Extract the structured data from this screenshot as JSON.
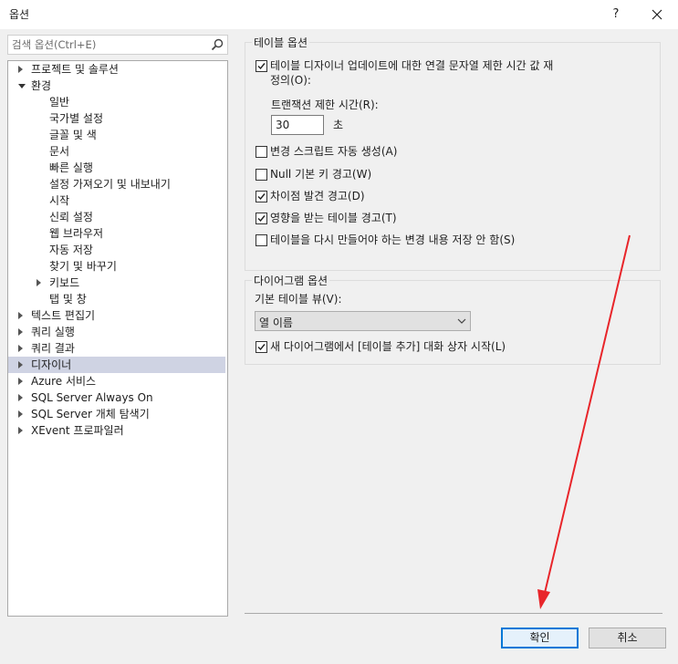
{
  "window": {
    "title": "옵션",
    "help_glyph": "?"
  },
  "search": {
    "placeholder": "검색 옵션(Ctrl+E)"
  },
  "tree": {
    "items": [
      {
        "label": "프로젝트 및 솔루션",
        "level": 0,
        "state": "collapsed"
      },
      {
        "label": "환경",
        "level": 0,
        "state": "expanded"
      },
      {
        "label": "일반",
        "level": 1,
        "state": "leaf"
      },
      {
        "label": "국가별 설정",
        "level": 1,
        "state": "leaf"
      },
      {
        "label": "글꼴 및 색",
        "level": 1,
        "state": "leaf"
      },
      {
        "label": "문서",
        "level": 1,
        "state": "leaf"
      },
      {
        "label": "빠른 실행",
        "level": 1,
        "state": "leaf"
      },
      {
        "label": "설정 가져오기 및 내보내기",
        "level": 1,
        "state": "leaf"
      },
      {
        "label": "시작",
        "level": 1,
        "state": "leaf"
      },
      {
        "label": "신뢰 설정",
        "level": 1,
        "state": "leaf"
      },
      {
        "label": "웹 브라우저",
        "level": 1,
        "state": "leaf"
      },
      {
        "label": "자동 저장",
        "level": 1,
        "state": "leaf"
      },
      {
        "label": "찾기 및 바꾸기",
        "level": 1,
        "state": "leaf"
      },
      {
        "label": "키보드",
        "level": 1,
        "state": "collapsed"
      },
      {
        "label": "탭 및 창",
        "level": 1,
        "state": "leaf"
      },
      {
        "label": "텍스트 편집기",
        "level": 0,
        "state": "collapsed"
      },
      {
        "label": "쿼리 실행",
        "level": 0,
        "state": "collapsed"
      },
      {
        "label": "쿼리 결과",
        "level": 0,
        "state": "collapsed"
      },
      {
        "label": "디자이너",
        "level": 0,
        "state": "collapsed",
        "selected": true
      },
      {
        "label": "Azure 서비스",
        "level": 0,
        "state": "collapsed"
      },
      {
        "label": "SQL Server Always On",
        "level": 0,
        "state": "collapsed"
      },
      {
        "label": "SQL Server 개체 탐색기",
        "level": 0,
        "state": "collapsed"
      },
      {
        "label": "XEvent 프로파일러",
        "level": 0,
        "state": "collapsed"
      }
    ]
  },
  "table_options": {
    "group_title": "테이블 옵션",
    "timeout_checkbox": {
      "label_line1": "테이블 디자이너 업데이트에 대한 연결 문자열 제한 시간 값 재",
      "label_line2": "정의(O):",
      "checked": true
    },
    "transaction_timeout_label": "트랜잭션 제한 시간(R):",
    "transaction_timeout_value": "30",
    "seconds_unit": "초",
    "checkboxes": [
      {
        "label": "변경 스크립트 자동 생성(A)",
        "checked": false
      },
      {
        "label": "Null 기본 키 경고(W)",
        "checked": false
      },
      {
        "label": "차이점 발견 경고(D)",
        "checked": true
      },
      {
        "label": "영향을 받는 테이블 경고(T)",
        "checked": true
      },
      {
        "label": "테이블을 다시 만들어야 하는 변경 내용 저장 안 함(S)",
        "checked": false
      }
    ]
  },
  "diagram_options": {
    "group_title": "다이어그램 옵션",
    "default_view_label": "기본 테이블 뷰(V):",
    "default_view_value": "열 이름",
    "add_table_checkbox": {
      "label": "새 다이어그램에서 [테이블 추가] 대화 상자 시작(L)",
      "checked": true
    }
  },
  "buttons": {
    "ok": "확인",
    "cancel": "취소"
  },
  "colors": {
    "selection": "#cfd3e3",
    "accent": "#0078d7",
    "annotation_arrow": "#e8252a"
  },
  "icons": {
    "search": "search-icon",
    "close": "close-icon",
    "chevron": "chevron-down-icon",
    "check": "checkmark-icon",
    "annotation": "red-arrow-annotation"
  }
}
